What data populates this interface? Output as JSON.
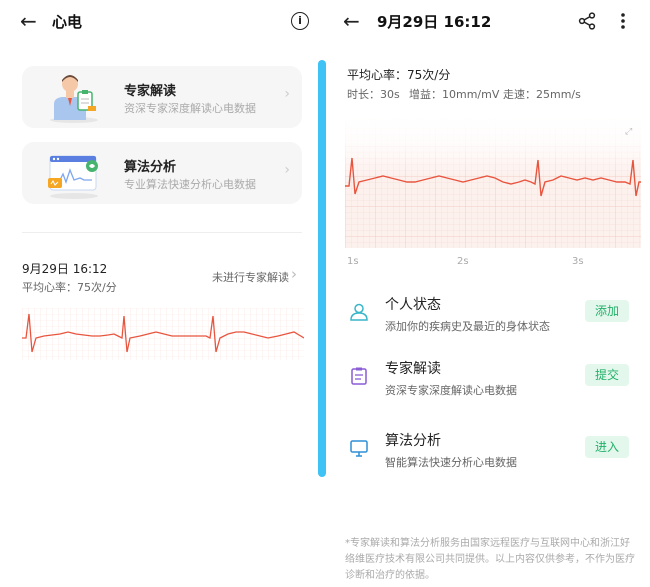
{
  "left": {
    "title": "心电",
    "info_glyph": "i",
    "cards": [
      {
        "title": "专家解读",
        "subtitle": "资深专家深度解读心电数据"
      },
      {
        "title": "算法分析",
        "subtitle": "专业算法快速分析心电数据"
      }
    ],
    "record": {
      "datetime": "9月29日 16:12",
      "avg_hr": "平均心率：75次/分",
      "status": "未进行专家解读"
    }
  },
  "right": {
    "title": "9月29日 16:12",
    "avg_hr": "平均心率：75次/分",
    "meta": {
      "duration": "时长：30s",
      "gain": "增益：10mm/mV",
      "speed": "走速：25mm/s"
    },
    "axis_labels": [
      "1s",
      "2s",
      "3s"
    ],
    "items": [
      {
        "title": "个人状态",
        "subtitle": "添加你的疾病史及最近的身体状态",
        "action": "添加",
        "icon": "person-icon"
      },
      {
        "title": "专家解读",
        "subtitle": "资深专家深度解读心电数据",
        "action": "提交",
        "icon": "clipboard-icon"
      },
      {
        "title": "算法分析",
        "subtitle": "智能算法快速分析心电数据",
        "action": "进入",
        "icon": "monitor-icon"
      }
    ],
    "footer": "*专家解读和算法分析服务由国家远程医疗与互联网中心和浙江好络维医疗技术有限公司共同提供。以上内容仅供参考，不作为医疗诊断和治疗的依据。"
  },
  "colors": {
    "accent": "#3fc3f5",
    "ecg_line": "#e8553f",
    "green_btn": "#24b06a",
    "green_bg": "#e3f7ec",
    "purple_icon": "#8a5cd6",
    "teal_icon": "#38b6c9",
    "blue_icon": "#2e8fd6"
  }
}
